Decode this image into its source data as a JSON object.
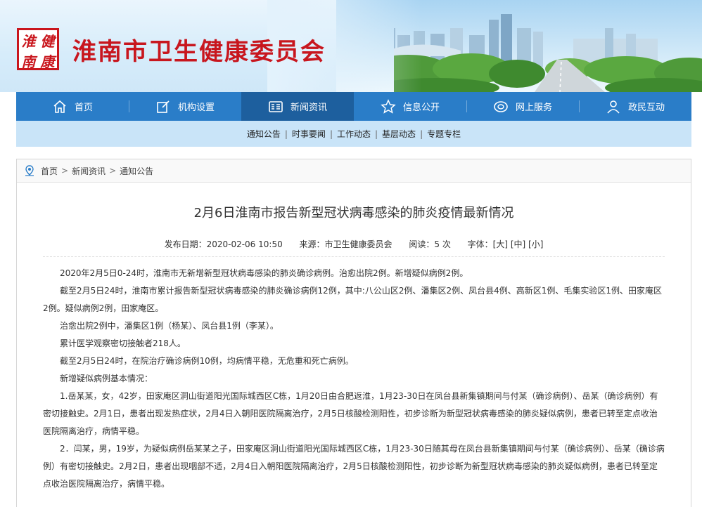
{
  "header": {
    "logo_chars": [
      "淮",
      "健",
      "南",
      "康"
    ],
    "site_title": "淮南市卫生健康委员会"
  },
  "nav": {
    "items": [
      {
        "label": "首页",
        "icon": "home-icon"
      },
      {
        "label": "机构设置",
        "icon": "edit-icon"
      },
      {
        "label": "新闻资讯",
        "icon": "news-icon",
        "active": true
      },
      {
        "label": "信息公开",
        "icon": "star-icon"
      },
      {
        "label": "网上服务",
        "icon": "service-icon"
      },
      {
        "label": "政民互动",
        "icon": "user-icon"
      }
    ],
    "sub_items": [
      "通知公告",
      "时事要闻",
      "工作动态",
      "基层动态",
      "专题专栏"
    ],
    "sub_sep": "|"
  },
  "breadcrumb": {
    "items": [
      "首页",
      "新闻资讯",
      "通知公告"
    ],
    "sep": ">"
  },
  "article": {
    "title": "2月6日淮南市报告新型冠状病毒感染的肺炎疫情最新情况",
    "publish_date": "发布日期：2020-02-06 10:50",
    "source": "来源：市卫生健康委员会",
    "reads": "阅读：5 次",
    "font_size": "字体：[大] [中] [小]",
    "paragraphs": [
      "2020年2月5日0-24时，淮南市无新增新型冠状病毒感染的肺炎确诊病例。治愈出院2例。新增疑似病例2例。",
      "截至2月5日24时，淮南市累计报告新型冠状病毒感染的肺炎确诊病例12例，其中:八公山区2例、潘集区2例、凤台县4例、高新区1例、毛集实验区1例、田家庵区2例。疑似病例2例，田家庵区。",
      "治愈出院2例中，潘集区1例（杨某）、凤台县1例（李某）。",
      "累计医学观察密切接触者218人。",
      "截至2月5日24时，在院治疗确诊病例10例，均病情平稳，无危重和死亡病例。",
      "新增疑似病例基本情况：",
      "1.岳某某，女，42岁，田家庵区洞山街道阳光国际城西区C栋，1月20日由合肥返淮，1月23-30日在凤台县新集镇期间与付某（确诊病例）、岳某（确诊病例）有密切接触史。2月1日，患者出现发热症状，2月4日入朝阳医院隔离治疗，2月5日核酸检测阳性，初步诊断为新型冠状病毒感染的肺炎疑似病例，患者已转至定点收治医院隔离治疗，病情平稳。",
      "2．闫某，男，19岁，为疑似病例岳某某之子，田家庵区洞山街道阳光国际城西区C栋，1月23-30日随其母在凤台县新集镇期间与付某（确诊病例）、岳某（确诊病例）有密切接触史。2月2日，患者出现咽部不适，2月4日入朝阳医院隔离治疗，2月5日核酸检测阳性，初步诊断为新型冠状病毒感染的肺炎疑似病例，患者已转至定点收治医院隔离治疗，病情平稳。"
    ]
  },
  "colors": {
    "brand_red": "#c8161e",
    "nav_blue": "#2a7dc8",
    "nav_active": "#1d5f9e",
    "subnav_bg": "#c9e4f8"
  }
}
